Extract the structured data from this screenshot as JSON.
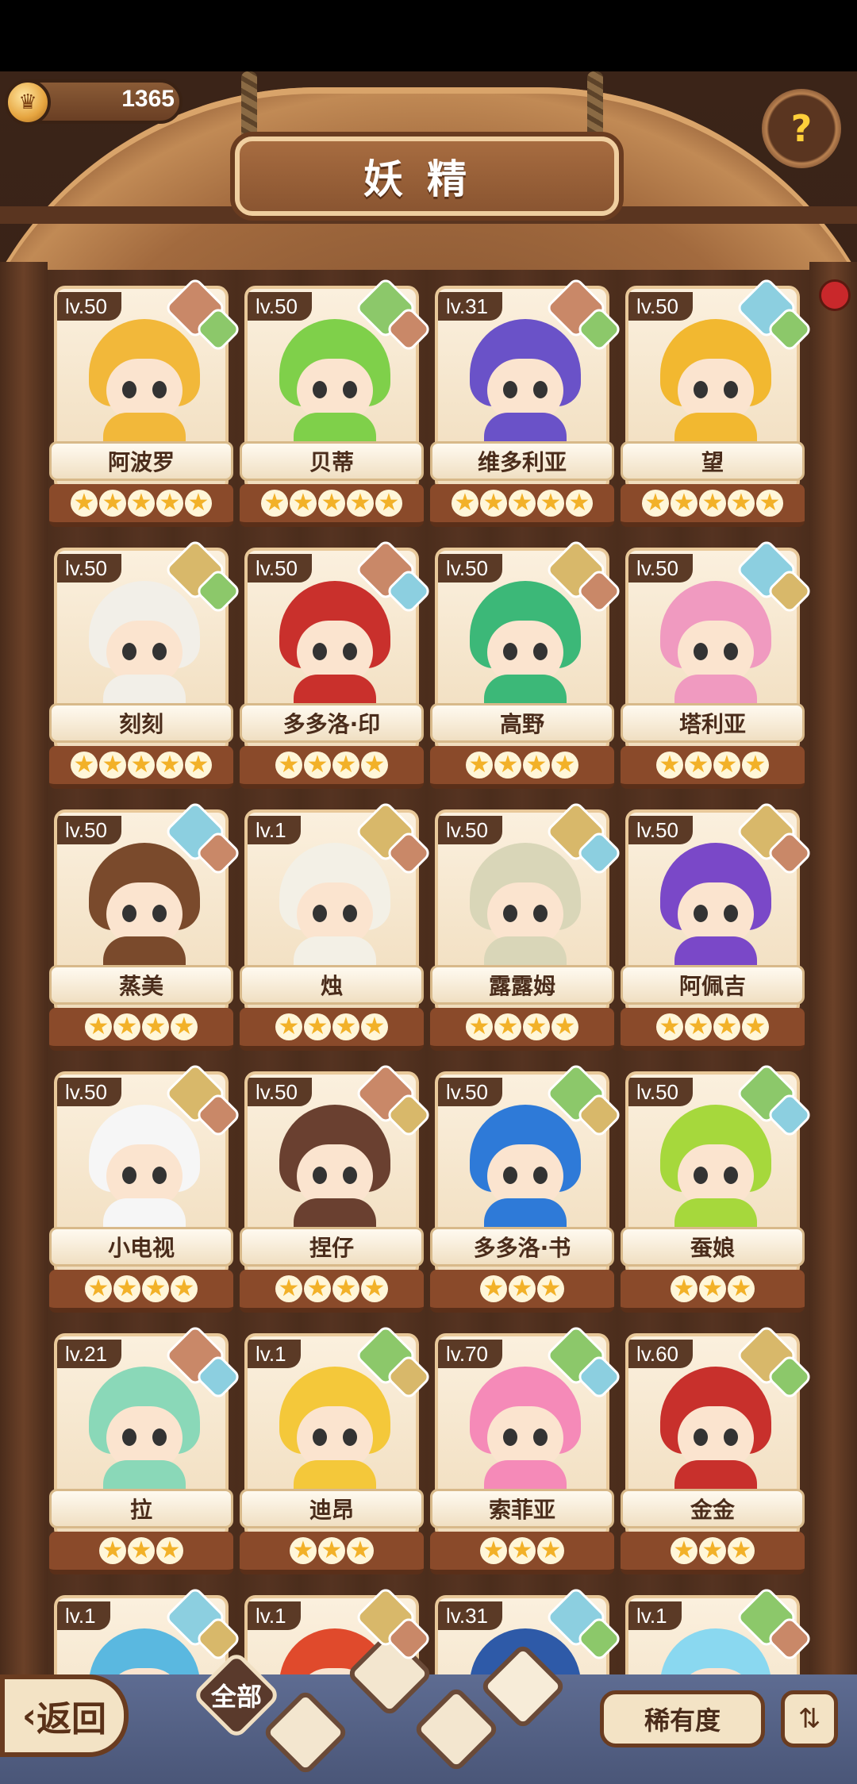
{
  "currency": {
    "value": "1365"
  },
  "title": "妖精",
  "help_icon": "?",
  "nav": {
    "back_label": "返回",
    "filter_all": "全部",
    "rarity_label": "稀有度",
    "sort_icon": "sort-icon"
  },
  "colors": {
    "fire": "#c98868",
    "leaf": "#8cc86a",
    "earth": "#d8b86a",
    "water": "#8ccfe0"
  },
  "fairies": [
    {
      "level": "lv.50",
      "name": "阿波罗",
      "stars": 5,
      "elements": [
        "fire",
        "leaf"
      ],
      "hair": "#f2b83a"
    },
    {
      "level": "lv.50",
      "name": "贝蒂",
      "stars": 5,
      "elements": [
        "leaf",
        "fire"
      ],
      "hair": "#7fd04a"
    },
    {
      "level": "lv.31",
      "name": "维多利亚",
      "stars": 5,
      "elements": [
        "fire",
        "leaf"
      ],
      "hair": "#6a52c8"
    },
    {
      "level": "lv.50",
      "name": "望",
      "stars": 5,
      "elements": [
        "water",
        "leaf"
      ],
      "hair": "#f2b830"
    },
    {
      "level": "lv.50",
      "name": "刻刻",
      "stars": 5,
      "elements": [
        "earth",
        "leaf"
      ],
      "hair": "#f2efe8"
    },
    {
      "level": "lv.50",
      "name": "多多洛·印",
      "stars": 4,
      "elements": [
        "fire",
        "water"
      ],
      "hair": "#c9302c"
    },
    {
      "level": "lv.50",
      "name": "高野",
      "stars": 4,
      "elements": [
        "earth",
        "fire"
      ],
      "hair": "#3cb878"
    },
    {
      "level": "lv.50",
      "name": "塔利亚",
      "stars": 4,
      "elements": [
        "water",
        "earth"
      ],
      "hair": "#f09ac0"
    },
    {
      "level": "lv.50",
      "name": "蒸美",
      "stars": 4,
      "elements": [
        "water",
        "fire"
      ],
      "hair": "#7a4a2c"
    },
    {
      "level": "lv.1",
      "name": "烛",
      "stars": 4,
      "elements": [
        "earth",
        "fire"
      ],
      "hair": "#f3f0e6"
    },
    {
      "level": "lv.50",
      "name": "露露姆",
      "stars": 4,
      "elements": [
        "earth",
        "water"
      ],
      "hair": "#d9d6b8"
    },
    {
      "level": "lv.50",
      "name": "阿佩吉",
      "stars": 4,
      "elements": [
        "earth",
        "fire"
      ],
      "hair": "#7a48c8"
    },
    {
      "level": "lv.50",
      "name": "小电视",
      "stars": 4,
      "elements": [
        "earth",
        "fire"
      ],
      "hair": "#f6f6f6"
    },
    {
      "level": "lv.50",
      "name": "捏仔",
      "stars": 4,
      "elements": [
        "fire",
        "earth"
      ],
      "hair": "#6a4030"
    },
    {
      "level": "lv.50",
      "name": "多多洛·书",
      "stars": 3,
      "elements": [
        "leaf",
        "earth"
      ],
      "hair": "#2e7ad8"
    },
    {
      "level": "lv.50",
      "name": "蚕娘",
      "stars": 3,
      "elements": [
        "leaf",
        "water"
      ],
      "hair": "#a6d83c"
    },
    {
      "level": "lv.21",
      "name": "拉",
      "stars": 3,
      "elements": [
        "fire",
        "water"
      ],
      "hair": "#8ad8b8"
    },
    {
      "level": "lv.1",
      "name": "迪昂",
      "stars": 3,
      "elements": [
        "leaf",
        "earth"
      ],
      "hair": "#f4c83a"
    },
    {
      "level": "lv.70",
      "name": "索菲亚",
      "stars": 3,
      "elements": [
        "leaf",
        "water"
      ],
      "hair": "#f58ab8"
    },
    {
      "level": "lv.60",
      "name": "金金",
      "stars": 3,
      "elements": [
        "earth",
        "leaf"
      ],
      "hair": "#c8302c"
    },
    {
      "level": "lv.1",
      "name": "",
      "stars": 0,
      "elements": [
        "water",
        "earth"
      ],
      "hair": "#5ab8e0"
    },
    {
      "level": "lv.1",
      "name": "",
      "stars": 0,
      "elements": [
        "earth",
        "fire"
      ],
      "hair": "#e04a2c"
    },
    {
      "level": "lv.31",
      "name": "",
      "stars": 0,
      "elements": [
        "water",
        "leaf"
      ],
      "hair": "#2e5aa8"
    },
    {
      "level": "lv.1",
      "name": "",
      "stars": 0,
      "elements": [
        "leaf",
        "fire"
      ],
      "hair": "#8ad8f0"
    }
  ]
}
